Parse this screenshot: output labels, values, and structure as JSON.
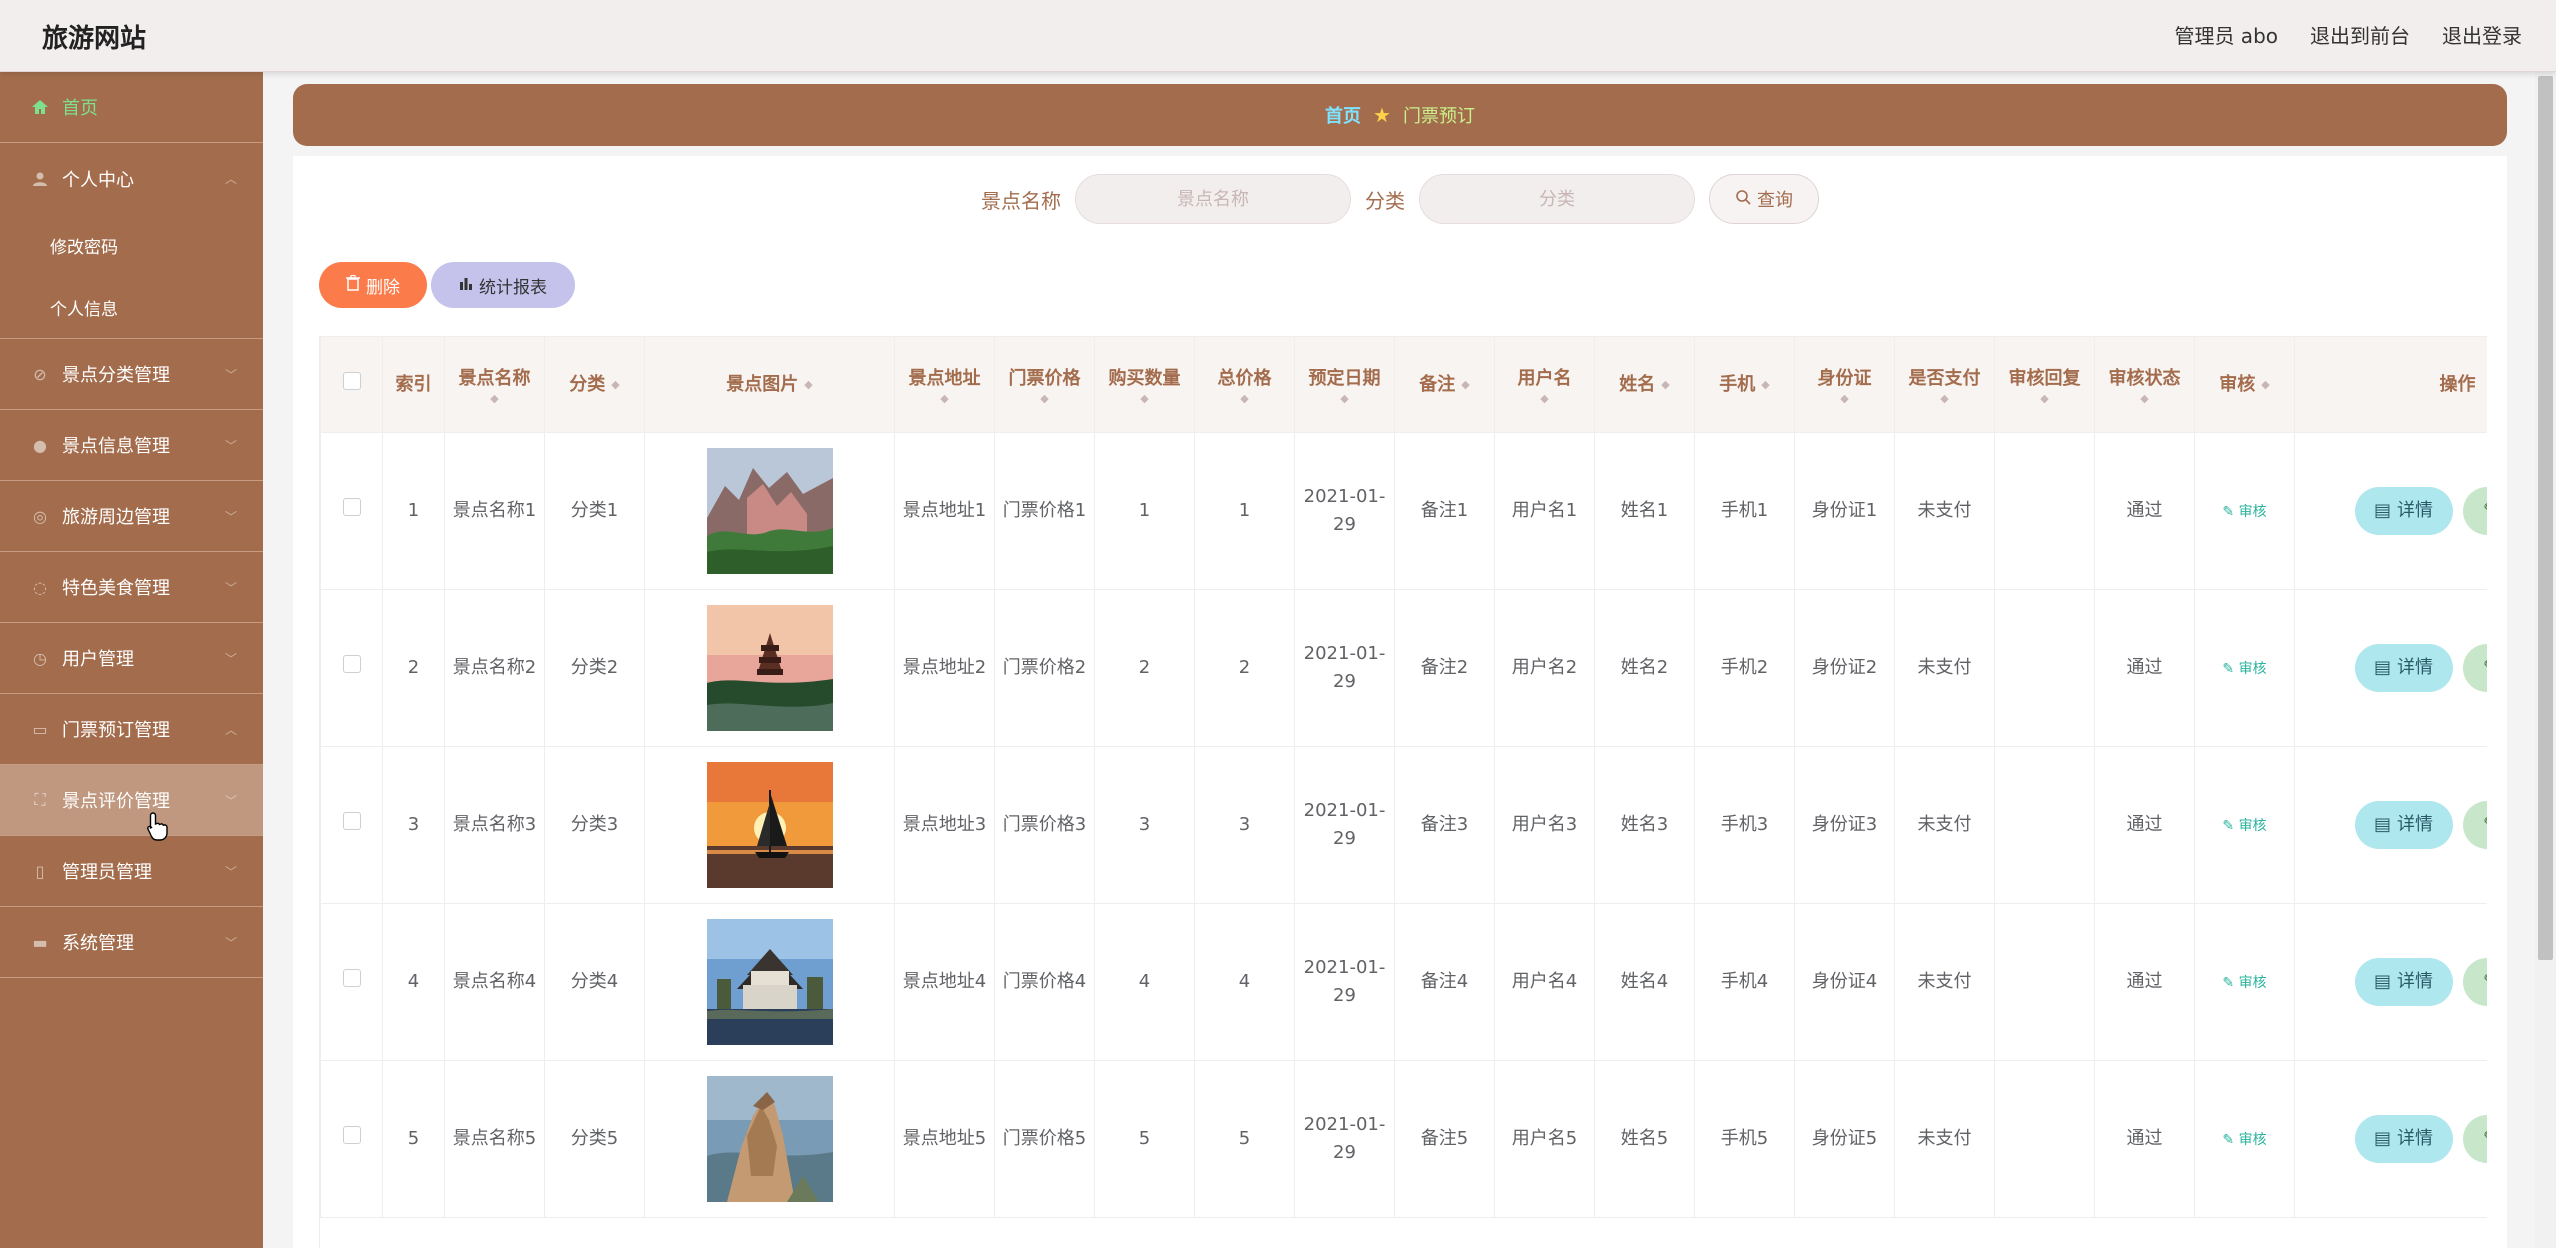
{
  "app": {
    "brand": "旅游网站"
  },
  "topbar": {
    "admin_label": "管理员 abo",
    "to_front": "退出到前台",
    "logout": "退出登录"
  },
  "sidebar": {
    "home": "首页",
    "personal": {
      "label": "个人中心",
      "children": [
        "修改密码",
        "个人信息"
      ]
    },
    "items": [
      "景点分类管理",
      "景点信息管理",
      "旅游周边管理",
      "特色美食管理",
      "用户管理",
      "门票预订管理",
      "景点评价管理",
      "管理员管理",
      "系统管理"
    ],
    "active": "景点评价管理"
  },
  "breadcrumb": {
    "home": "首页",
    "current": "门票预订"
  },
  "search": {
    "name_label": "景点名称",
    "name_placeholder": "景点名称",
    "category_label": "分类",
    "category_placeholder": "分类",
    "query_button": "查询"
  },
  "actions": {
    "delete": "删除",
    "report": "统计报表"
  },
  "table": {
    "headers": [
      "索引",
      "景点名称",
      "分类",
      "景点图片",
      "景点地址",
      "门票价格",
      "购买数量",
      "总价格",
      "预定日期",
      "备注",
      "用户名",
      "姓名",
      "手机",
      "身份证",
      "是否支付",
      "审核回复",
      "审核状态",
      "审核",
      "操作"
    ],
    "audit_link": "审核",
    "detail_button": "详情",
    "edit_button": "修改",
    "rows": [
      {
        "index": "1",
        "name": "景点名称1",
        "category": "分类1",
        "address": "景点地址1",
        "price": "门票价格1",
        "qty": "1",
        "total": "1",
        "date": "2021-01-29",
        "remark": "备注1",
        "username": "用户名1",
        "realname": "姓名1",
        "phone": "手机1",
        "idcard": "身份证1",
        "paid": "未支付",
        "reply": "",
        "status": "通过",
        "image": "mountain-cliffs-photo"
      },
      {
        "index": "2",
        "name": "景点名称2",
        "category": "分类2",
        "address": "景点地址2",
        "price": "门票价格2",
        "qty": "2",
        "total": "2",
        "date": "2021-01-29",
        "remark": "备注2",
        "username": "用户名2",
        "realname": "姓名2",
        "phone": "手机2",
        "idcard": "身份证2",
        "paid": "未支付",
        "reply": "",
        "status": "通过",
        "image": "pagoda-sunset-photo"
      },
      {
        "index": "3",
        "name": "景点名称3",
        "category": "分类3",
        "address": "景点地址3",
        "price": "门票价格3",
        "qty": "3",
        "total": "3",
        "date": "2021-01-29",
        "remark": "备注3",
        "username": "用户名3",
        "realname": "姓名3",
        "phone": "手机3",
        "idcard": "身份证3",
        "paid": "未支付",
        "reply": "",
        "status": "通过",
        "image": "sailboat-sunset-photo"
      },
      {
        "index": "4",
        "name": "景点名称4",
        "category": "分类4",
        "address": "景点地址4",
        "price": "门票价格4",
        "qty": "4",
        "total": "4",
        "date": "2021-01-29",
        "remark": "备注4",
        "username": "用户名4",
        "realname": "姓名4",
        "phone": "手机4",
        "idcard": "身份证4",
        "paid": "未支付",
        "reply": "",
        "status": "通过",
        "image": "pavilion-lake-photo"
      },
      {
        "index": "5",
        "name": "景点名称5",
        "category": "分类5",
        "address": "景点地址5",
        "price": "门票价格5",
        "qty": "5",
        "total": "5",
        "date": "2021-01-29",
        "remark": "备注5",
        "username": "用户名5",
        "realname": "姓名5",
        "phone": "手机5",
        "idcard": "身份证5",
        "paid": "未支付",
        "reply": "",
        "status": "通过",
        "image": "rock-peak-photo"
      }
    ]
  },
  "colors": {
    "brown": "#a36d4d",
    "accent_green": "#7ee08a",
    "delete_orange": "#fb7b4a",
    "report_lavender": "#c5c3ec",
    "detail_cyan": "#aee7ee",
    "edit_green": "#c8e6c9"
  }
}
